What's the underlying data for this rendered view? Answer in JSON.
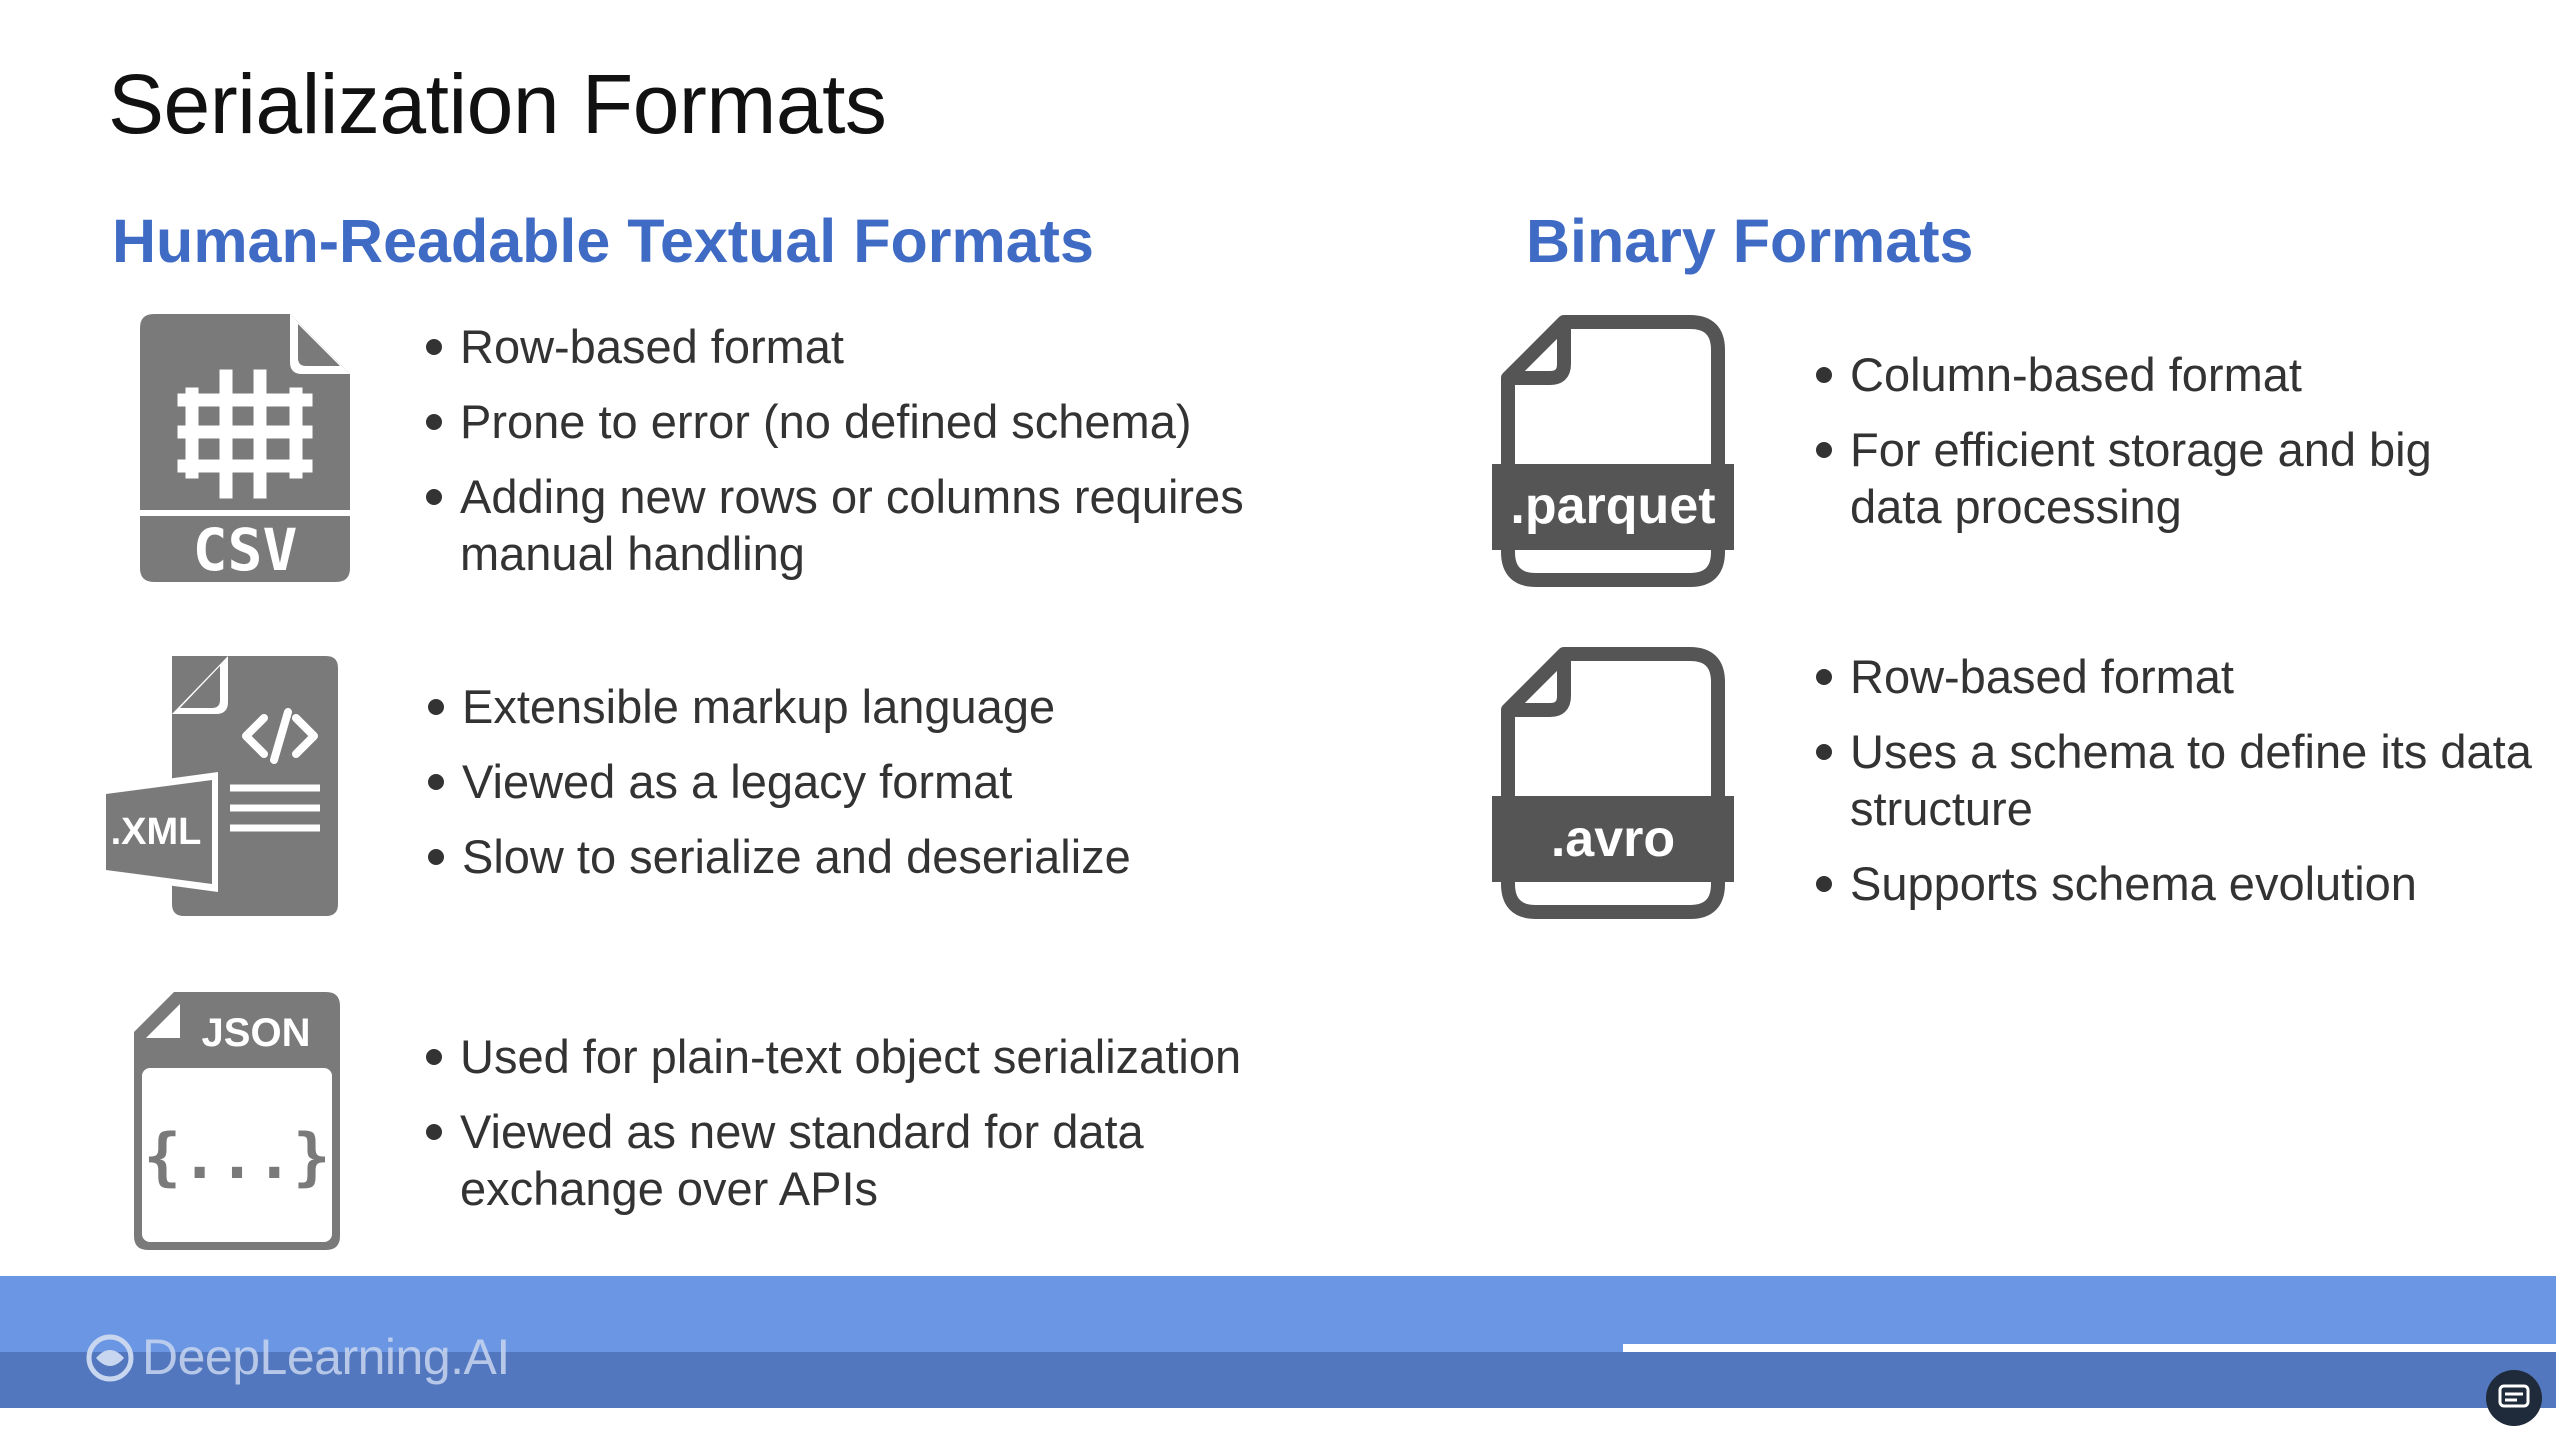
{
  "slide": {
    "title": "Serialization Formats",
    "textual": {
      "heading": "Human-Readable Textual Formats",
      "csv": {
        "icon_label": "CSV",
        "bullets": [
          "Row-based format",
          "Prone to error (no defined schema)",
          "Adding new rows or columns requires manual handling"
        ]
      },
      "xml": {
        "icon_label": ".XML",
        "bullets": [
          "Extensible markup language",
          "Viewed as a legacy format",
          "Slow to serialize and deserialize"
        ]
      },
      "json": {
        "icon_label": "JSON",
        "icon_symbol": "{...}",
        "bullets": [
          "Used for plain-text object serialization",
          "Viewed as new standard for data exchange over APIs"
        ]
      }
    },
    "binary": {
      "heading": "Binary Formats",
      "parquet": {
        "icon_label": ".parquet",
        "bullets": [
          "Column-based format",
          "For efficient storage and big data processing"
        ]
      },
      "avro": {
        "icon_label": ".avro",
        "bullets": [
          "Row-based format",
          "Uses a schema to define its data structure",
          "Supports schema evolution"
        ]
      }
    }
  },
  "footer": {
    "brand": "DeepLearning.AI",
    "progress": 0.635
  },
  "colors": {
    "heading_blue": "#3f6bc4",
    "icon_gray": "#7a7a7a",
    "footer_blue": "#6a96e3"
  },
  "icons": {
    "csv": "csv-file-icon",
    "xml": "xml-file-icon",
    "json": "json-file-icon",
    "parquet": "parquet-file-icon",
    "avro": "avro-file-icon",
    "brand": "deeplearning-logo-icon",
    "corner": "captions-icon"
  }
}
